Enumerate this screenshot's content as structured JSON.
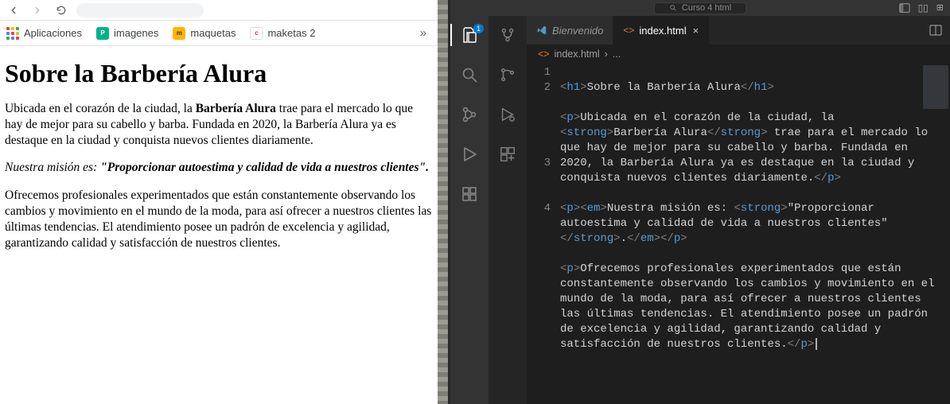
{
  "browser": {
    "bookmarks": {
      "apps": "Aplicaciones",
      "imagenes": "imagenes",
      "maquetas": "maquetas",
      "maketas2": "maketas 2"
    },
    "chevron": "»",
    "page": {
      "title": "Sobre la Barbería Alura",
      "p1_a": "Ubicada en el corazón de la ciudad, la ",
      "p1_strong": "Barbería Alura",
      "p1_b": " trae para el mercado lo que hay de mejor para su cabello y barba. Fundada en 2020, la Barbería Alura ya es destaque en la ciudad y conquista nuevos clientes diariamente.",
      "p2_a": "Nuestra misión es: ",
      "p2_strong": "\"Proporcionar autoestima y calidad de vida a nuestros clientes\".",
      "p3": "Ofrecemos profesionales experimentados que están constantemente observando los cambios y movimiento en el mundo de la moda, para así ofrecer a nuestros clientes las últimas tendencias. El atendimiento posee un padrón de excelencia y agilidad, garantizando calidad y satisfacción de nuestros clientes."
    }
  },
  "vscode": {
    "titlebar": {
      "search": "Curso 4 html",
      "layout_r": "⊞"
    },
    "activity": {
      "explorer_badge": "1"
    },
    "tabs": {
      "welcome": "Bienvenido",
      "file": "index.html",
      "close": "×"
    },
    "breadcrumbs": {
      "file": "index.html",
      "sep": "›",
      "more": "..."
    },
    "lines": [
      "1",
      "2",
      "3",
      "4"
    ],
    "code": {
      "l1": {
        "t1": "h1",
        "txt": "Sobre la Barbería Alura",
        "t2": "h1"
      },
      "l2": {
        "t1": "p",
        "txt_a": "Ubicada en el corazón de la ciudad, la ",
        "t2": "strong",
        "txt_b": "Barbería Alura",
        "t3": "strong",
        "txt_c": " trae para el mercado lo que hay de mejor para su cabello y barba. Fundada en 2020, la Barbería Alura ya es destaque en la ciudad y conquista nuevos clientes diariamente.",
        "t4": "p"
      },
      "l3": {
        "t1": "p",
        "t2": "em",
        "txt_a": "Nuestra misión es: ",
        "t3": "strong",
        "txt_b": "\"Proporcionar autoestima y calidad de vida a nuestros clientes\"",
        "t4": "strong",
        "txt_c": ".",
        "t5": "em",
        "t6": "p"
      },
      "l4": {
        "t1": "p",
        "txt": "Ofrecemos profesionales experimentados que están constantemente observando los cambios y movimiento en el mundo de la moda, para así ofrecer a nuestros clientes las últimas tendencias. El atendimiento posee un padrón de excelencia y agilidad, garantizando calidad y satisfacción de nuestros clientes.",
        "t2": "p"
      }
    }
  }
}
